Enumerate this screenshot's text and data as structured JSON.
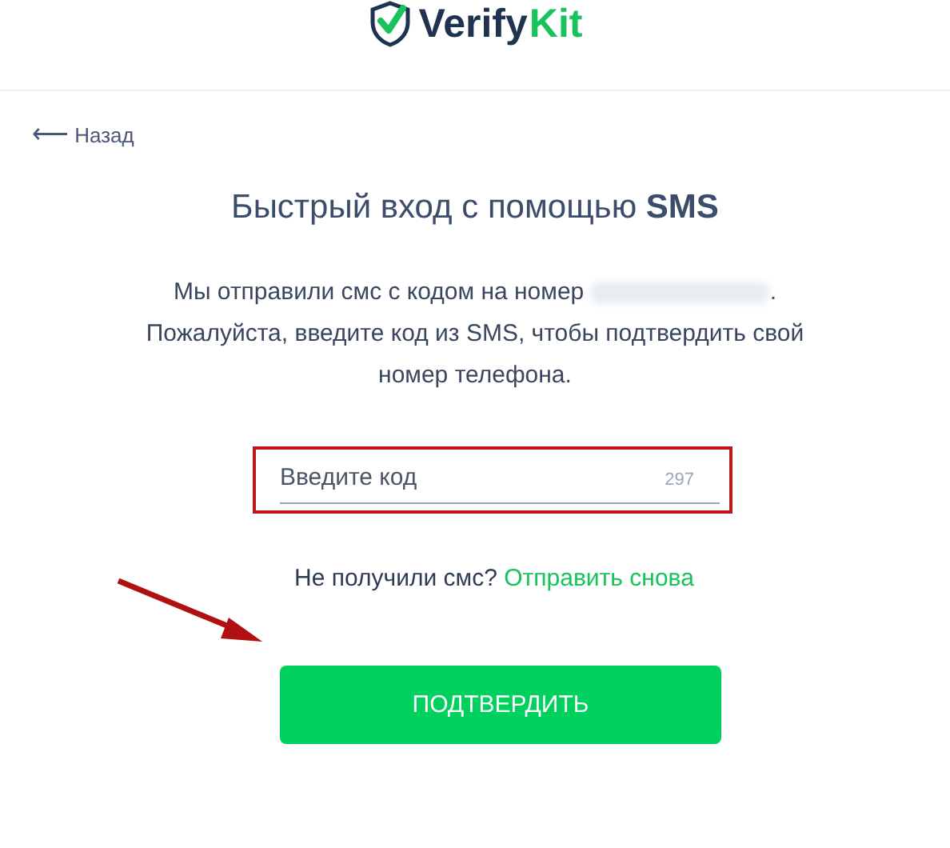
{
  "header": {
    "brand": "Verify",
    "brand_accent": "Kit"
  },
  "back_link": {
    "arrow": "⟵",
    "label": "Назад"
  },
  "title": "Быстрый вход с помощью **SMS**",
  "message": {
    "before": "Мы отправили смс с кодом на номер",
    "after": ".",
    "rest": "Пожалуйста, введите код из SMS, чтобы подтвердить свой номер телефона."
  },
  "code_field": {
    "placeholder": "Введите код",
    "counter": "297",
    "highlighted": true
  },
  "resend": {
    "question": "Не получили смс?",
    "link": "Отправить снова"
  },
  "confirm_button": "ПОДТВЕРДИТЬ",
  "annotation_arrow": true
}
